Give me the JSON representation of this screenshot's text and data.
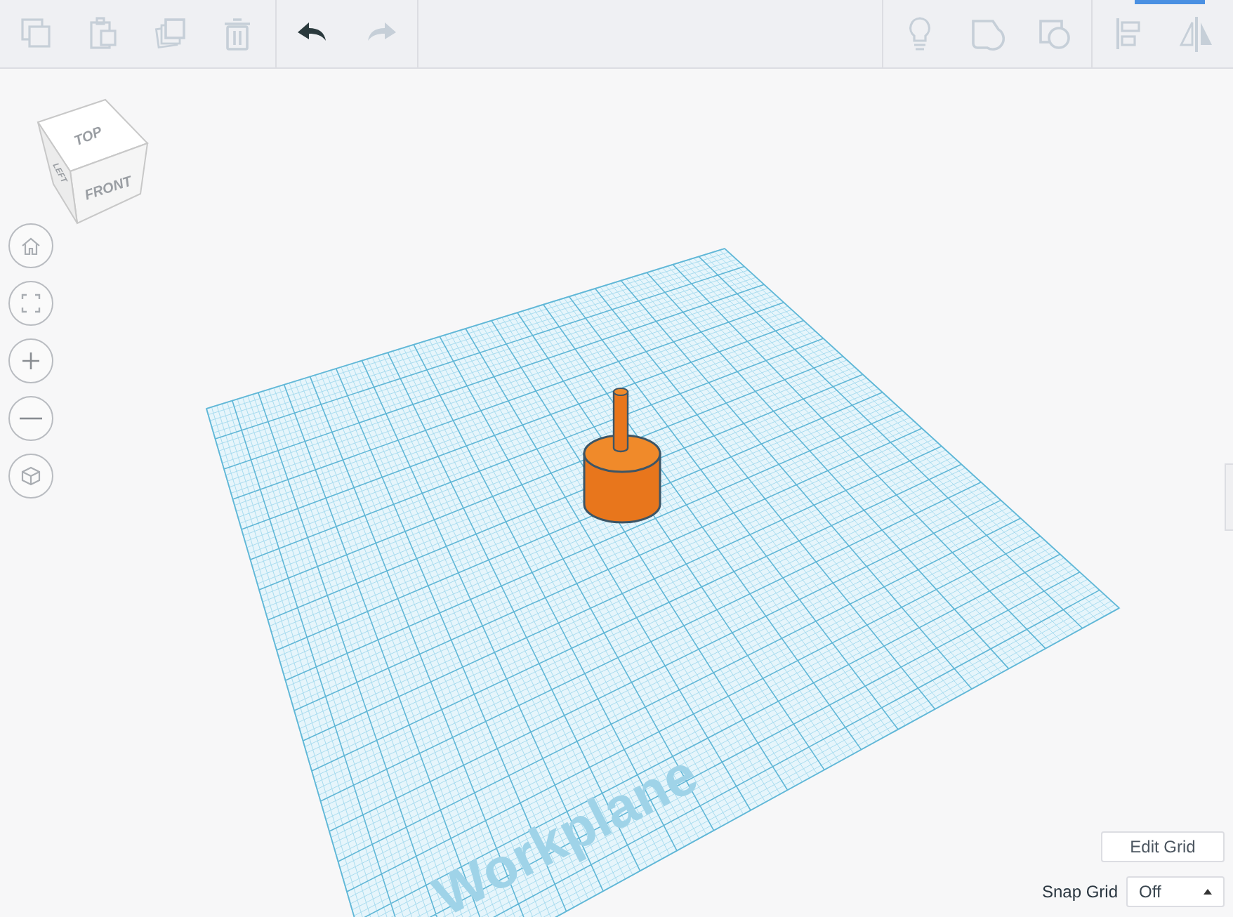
{
  "toolbar": {
    "edit_buttons": [
      {
        "kind": "copy",
        "disabled": true
      },
      {
        "kind": "paste",
        "disabled": true
      },
      {
        "kind": "duplicate",
        "disabled": true
      },
      {
        "kind": "delete",
        "disabled": true
      }
    ],
    "history_buttons": [
      {
        "kind": "undo",
        "disabled": false
      },
      {
        "kind": "redo",
        "disabled": true
      }
    ],
    "view_buttons": [
      {
        "kind": "bulb",
        "disabled": true
      },
      {
        "kind": "shape",
        "disabled": true
      },
      {
        "kind": "shape-circle",
        "disabled": true
      }
    ],
    "arrange_buttons": [
      {
        "kind": "align",
        "disabled": true
      },
      {
        "kind": "mirror",
        "disabled": true
      }
    ]
  },
  "view_cube": {
    "top": "TOP",
    "front": "FRONT",
    "left": "LEFT"
  },
  "nav_buttons": [
    {
      "kind": "home"
    },
    {
      "kind": "fit"
    },
    {
      "kind": "zoom-in"
    },
    {
      "kind": "zoom-out"
    },
    {
      "kind": "perspective"
    }
  ],
  "workplane": {
    "label": "Workplane"
  },
  "edit_grid_button": "Edit Grid",
  "snap_grid": {
    "label": "Snap Grid",
    "value": "Off"
  }
}
